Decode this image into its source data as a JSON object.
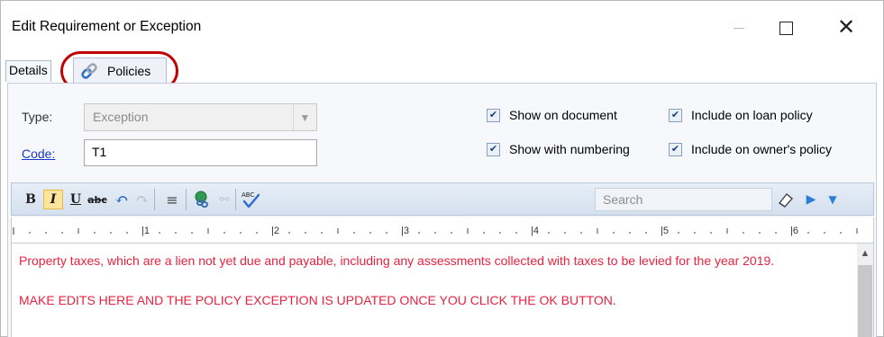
{
  "window": {
    "title": "Edit Requirement or Exception"
  },
  "tabs": [
    {
      "label": "Details"
    },
    {
      "label": "Policies",
      "icon": "link-icon"
    }
  ],
  "form": {
    "type_label": "Type:",
    "type_value": "Exception",
    "code_label": "Code:",
    "code_value": "T1"
  },
  "options": [
    {
      "label": "Show on document",
      "checked": true
    },
    {
      "label": "Include on loan policy",
      "checked": true
    },
    {
      "label": "Show with numbering",
      "checked": true
    },
    {
      "label": "Include on owner's policy",
      "checked": true
    }
  ],
  "toolbar": {
    "bold": "B",
    "italic": "I",
    "underline": "U",
    "strike": "abc",
    "search_placeholder": "Search"
  },
  "ruler": {
    "marks": [
      "1",
      "2",
      "3",
      "4",
      "5",
      "6"
    ]
  },
  "editor": {
    "paragraph1": "Property taxes, which are a lien not yet due and payable, including any assessments collected with taxes to be levied for the year 2019.",
    "paragraph2": "MAKE EDITS HERE AND THE POLICY EXCEPTION IS UPDATED ONCE YOU CLICK THE OK BUTTON.",
    "text_color": "#e8223f"
  },
  "colors": {
    "highlight_ring": "#c00000",
    "link": "#1a39c6",
    "accent": "#2b7fd8"
  }
}
